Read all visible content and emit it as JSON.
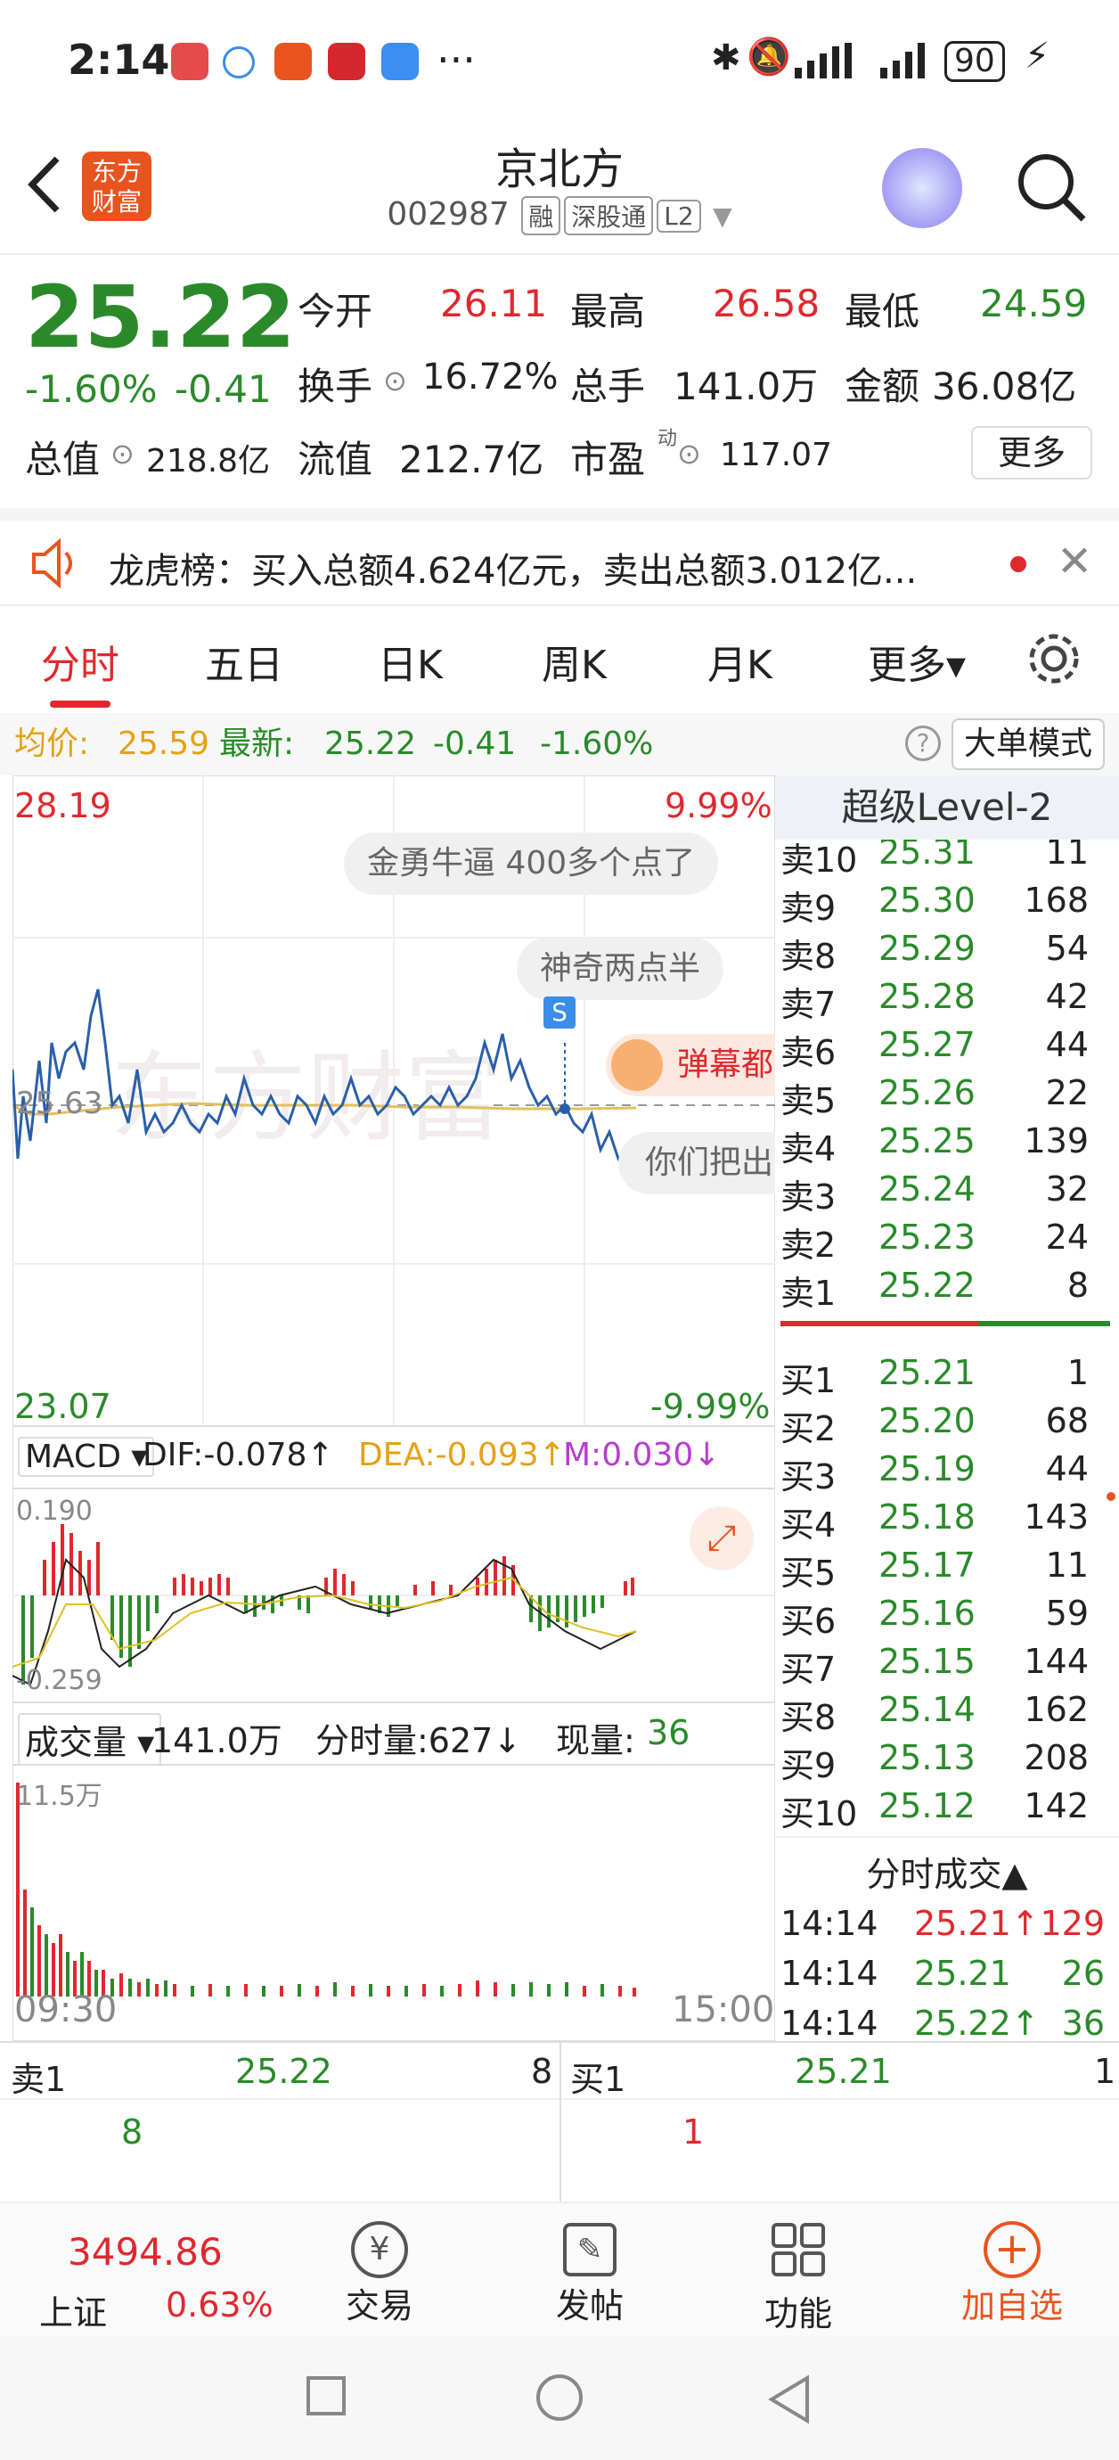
{
  "status_bar": {
    "time": "2:14",
    "dots": "···",
    "battery": "90"
  },
  "header": {
    "logo_line1": "东方",
    "logo_line2": "财富",
    "title": "京北方",
    "code": "002987",
    "tags": [
      "融",
      "深股通",
      "L2"
    ]
  },
  "quote": {
    "price": "25.22",
    "change_pct": "-1.60%",
    "change": "-0.41",
    "fields": [
      {
        "label": "今开",
        "value": "26.11",
        "color": "red"
      },
      {
        "label": "最高",
        "value": "26.58",
        "color": "red"
      },
      {
        "label": "最低",
        "value": "24.59",
        "color": "green"
      },
      {
        "label": "换手",
        "value": "16.72%"
      },
      {
        "label": "总手",
        "value": "141.0万"
      },
      {
        "label": "金额",
        "value": "36.08亿"
      },
      {
        "label": "总值",
        "value": "218.8亿"
      },
      {
        "label": "流值",
        "value": "212.7亿"
      },
      {
        "label": "市盈",
        "value": "117.07",
        "sup": "动"
      }
    ],
    "more": "更多"
  },
  "notice": {
    "text": "龙虎榜：买入总额4.624亿元，卖出总额3.012亿..."
  },
  "tabs": [
    "分时",
    "五日",
    "日K",
    "周K",
    "月K",
    "更多▾"
  ],
  "info_bar": {
    "avg_label": "均价:",
    "avg": "25.59",
    "latest_label": "最新:",
    "latest": "25.22",
    "chg": "-0.41",
    "pct": "-1.60%",
    "mode": "大单模式"
  },
  "chart": {
    "top": "28.19",
    "top_pct": "9.99%",
    "bottom": "23.07",
    "bottom_pct": "-9.99%",
    "mid": "25.63",
    "danmu": [
      "金勇牛逼 400多个点了",
      "神奇两点半",
      "弹幕都",
      "你们把出"
    ],
    "s_marker": "S",
    "macd": {
      "label": "MACD",
      "dif": "DIF:-0.078↑",
      "dea": "DEA:-0.093↑",
      "m": "M:0.030↓",
      "high": "0.190",
      "low": "-0.259"
    },
    "vol": {
      "label": "成交量",
      "total": "141.0万",
      "fs": "分时量:627↓",
      "now_label": "现量:",
      "now": "36",
      "max": "11.5万",
      "start": "09:30",
      "end": "15:00"
    }
  },
  "order_book": {
    "title": "超级Level-2",
    "asks": [
      {
        "label": "卖10",
        "price": "25.31",
        "qty": "11"
      },
      {
        "label": "卖9",
        "price": "25.30",
        "qty": "168"
      },
      {
        "label": "卖8",
        "price": "25.29",
        "qty": "54"
      },
      {
        "label": "卖7",
        "price": "25.28",
        "qty": "42"
      },
      {
        "label": "卖6",
        "price": "25.27",
        "qty": "44"
      },
      {
        "label": "卖5",
        "price": "25.26",
        "qty": "22"
      },
      {
        "label": "卖4",
        "price": "25.25",
        "qty": "139"
      },
      {
        "label": "卖3",
        "price": "25.24",
        "qty": "32"
      },
      {
        "label": "卖2",
        "price": "25.23",
        "qty": "24"
      },
      {
        "label": "卖1",
        "price": "25.22",
        "qty": "8"
      }
    ],
    "bids": [
      {
        "label": "买1",
        "price": "25.21",
        "qty": "1"
      },
      {
        "label": "买2",
        "price": "25.20",
        "qty": "68"
      },
      {
        "label": "买3",
        "price": "25.19",
        "qty": "44"
      },
      {
        "label": "买4",
        "price": "25.18",
        "qty": "143"
      },
      {
        "label": "买5",
        "price": "25.17",
        "qty": "11"
      },
      {
        "label": "买6",
        "price": "25.16",
        "qty": "59"
      },
      {
        "label": "买7",
        "price": "25.15",
        "qty": "144"
      },
      {
        "label": "买8",
        "price": "25.14",
        "qty": "162"
      },
      {
        "label": "买9",
        "price": "25.13",
        "qty": "208"
      },
      {
        "label": "买10",
        "price": "25.12",
        "qty": "142"
      }
    ]
  },
  "trades": {
    "title": "分时成交▲",
    "rows": [
      {
        "time": "14:14",
        "price": "25.21↑",
        "qty": "129",
        "pc": "red",
        "qc": "red"
      },
      {
        "time": "14:14",
        "price": "25.21",
        "qty": "26",
        "pc": "green",
        "qc": "green"
      },
      {
        "time": "14:14",
        "price": "25.22↑",
        "qty": "36",
        "pc": "green",
        "qc": "green"
      }
    ]
  },
  "bottom_quote": {
    "sell_label": "卖1",
    "sell_price": "25.22",
    "sell_qty": "8",
    "sell_sub": "8",
    "buy_label": "买1",
    "buy_price": "25.21",
    "buy_qty": "1",
    "buy_sub": "1"
  },
  "nav": {
    "index_value": "3494.86",
    "index_name": "上证",
    "index_pct": "0.63%",
    "items": [
      "交易",
      "发帖",
      "功能",
      "加自选"
    ]
  }
}
